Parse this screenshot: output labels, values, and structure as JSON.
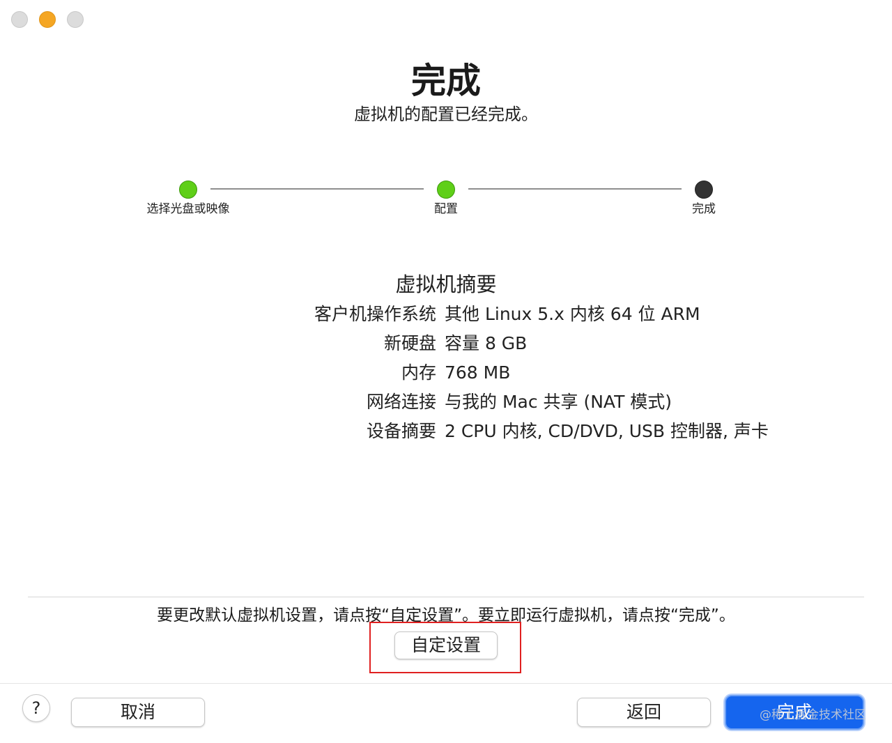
{
  "header": {
    "title": "完成",
    "subtitle": "虚拟机的配置已经完成。"
  },
  "steps": [
    {
      "label": "选择光盘或映像",
      "status": "done"
    },
    {
      "label": "配置",
      "status": "done"
    },
    {
      "label": "完成",
      "status": "current"
    }
  ],
  "summary": {
    "title": "虚拟机摘要",
    "rows": [
      {
        "key": "客户机操作系统",
        "value": "其他 Linux 5.x 内核 64 位 ARM"
      },
      {
        "key": "新硬盘",
        "value": "容量 8 GB"
      },
      {
        "key": "内存",
        "value": "768 MB"
      },
      {
        "key": "网络连接",
        "value": "与我的 Mac 共享 (NAT 模式)"
      },
      {
        "key": "设备摘要",
        "value": "2 CPU 内核, CD/DVD, USB 控制器, 声卡"
      }
    ]
  },
  "hint": "要更改默认虚拟机设置，请点按“自定设置”。要立即运行虚拟机，请点按“完成”。",
  "buttons": {
    "custom": "自定设置",
    "help": "?",
    "cancel": "取消",
    "back": "返回",
    "finish": "完成"
  },
  "watermark": "@稀土掘金技术社区",
  "colors": {
    "step_done": "#5fcf18",
    "step_current": "#333333",
    "primary_button": "#1565ee",
    "highlight_box": "#e02020"
  }
}
